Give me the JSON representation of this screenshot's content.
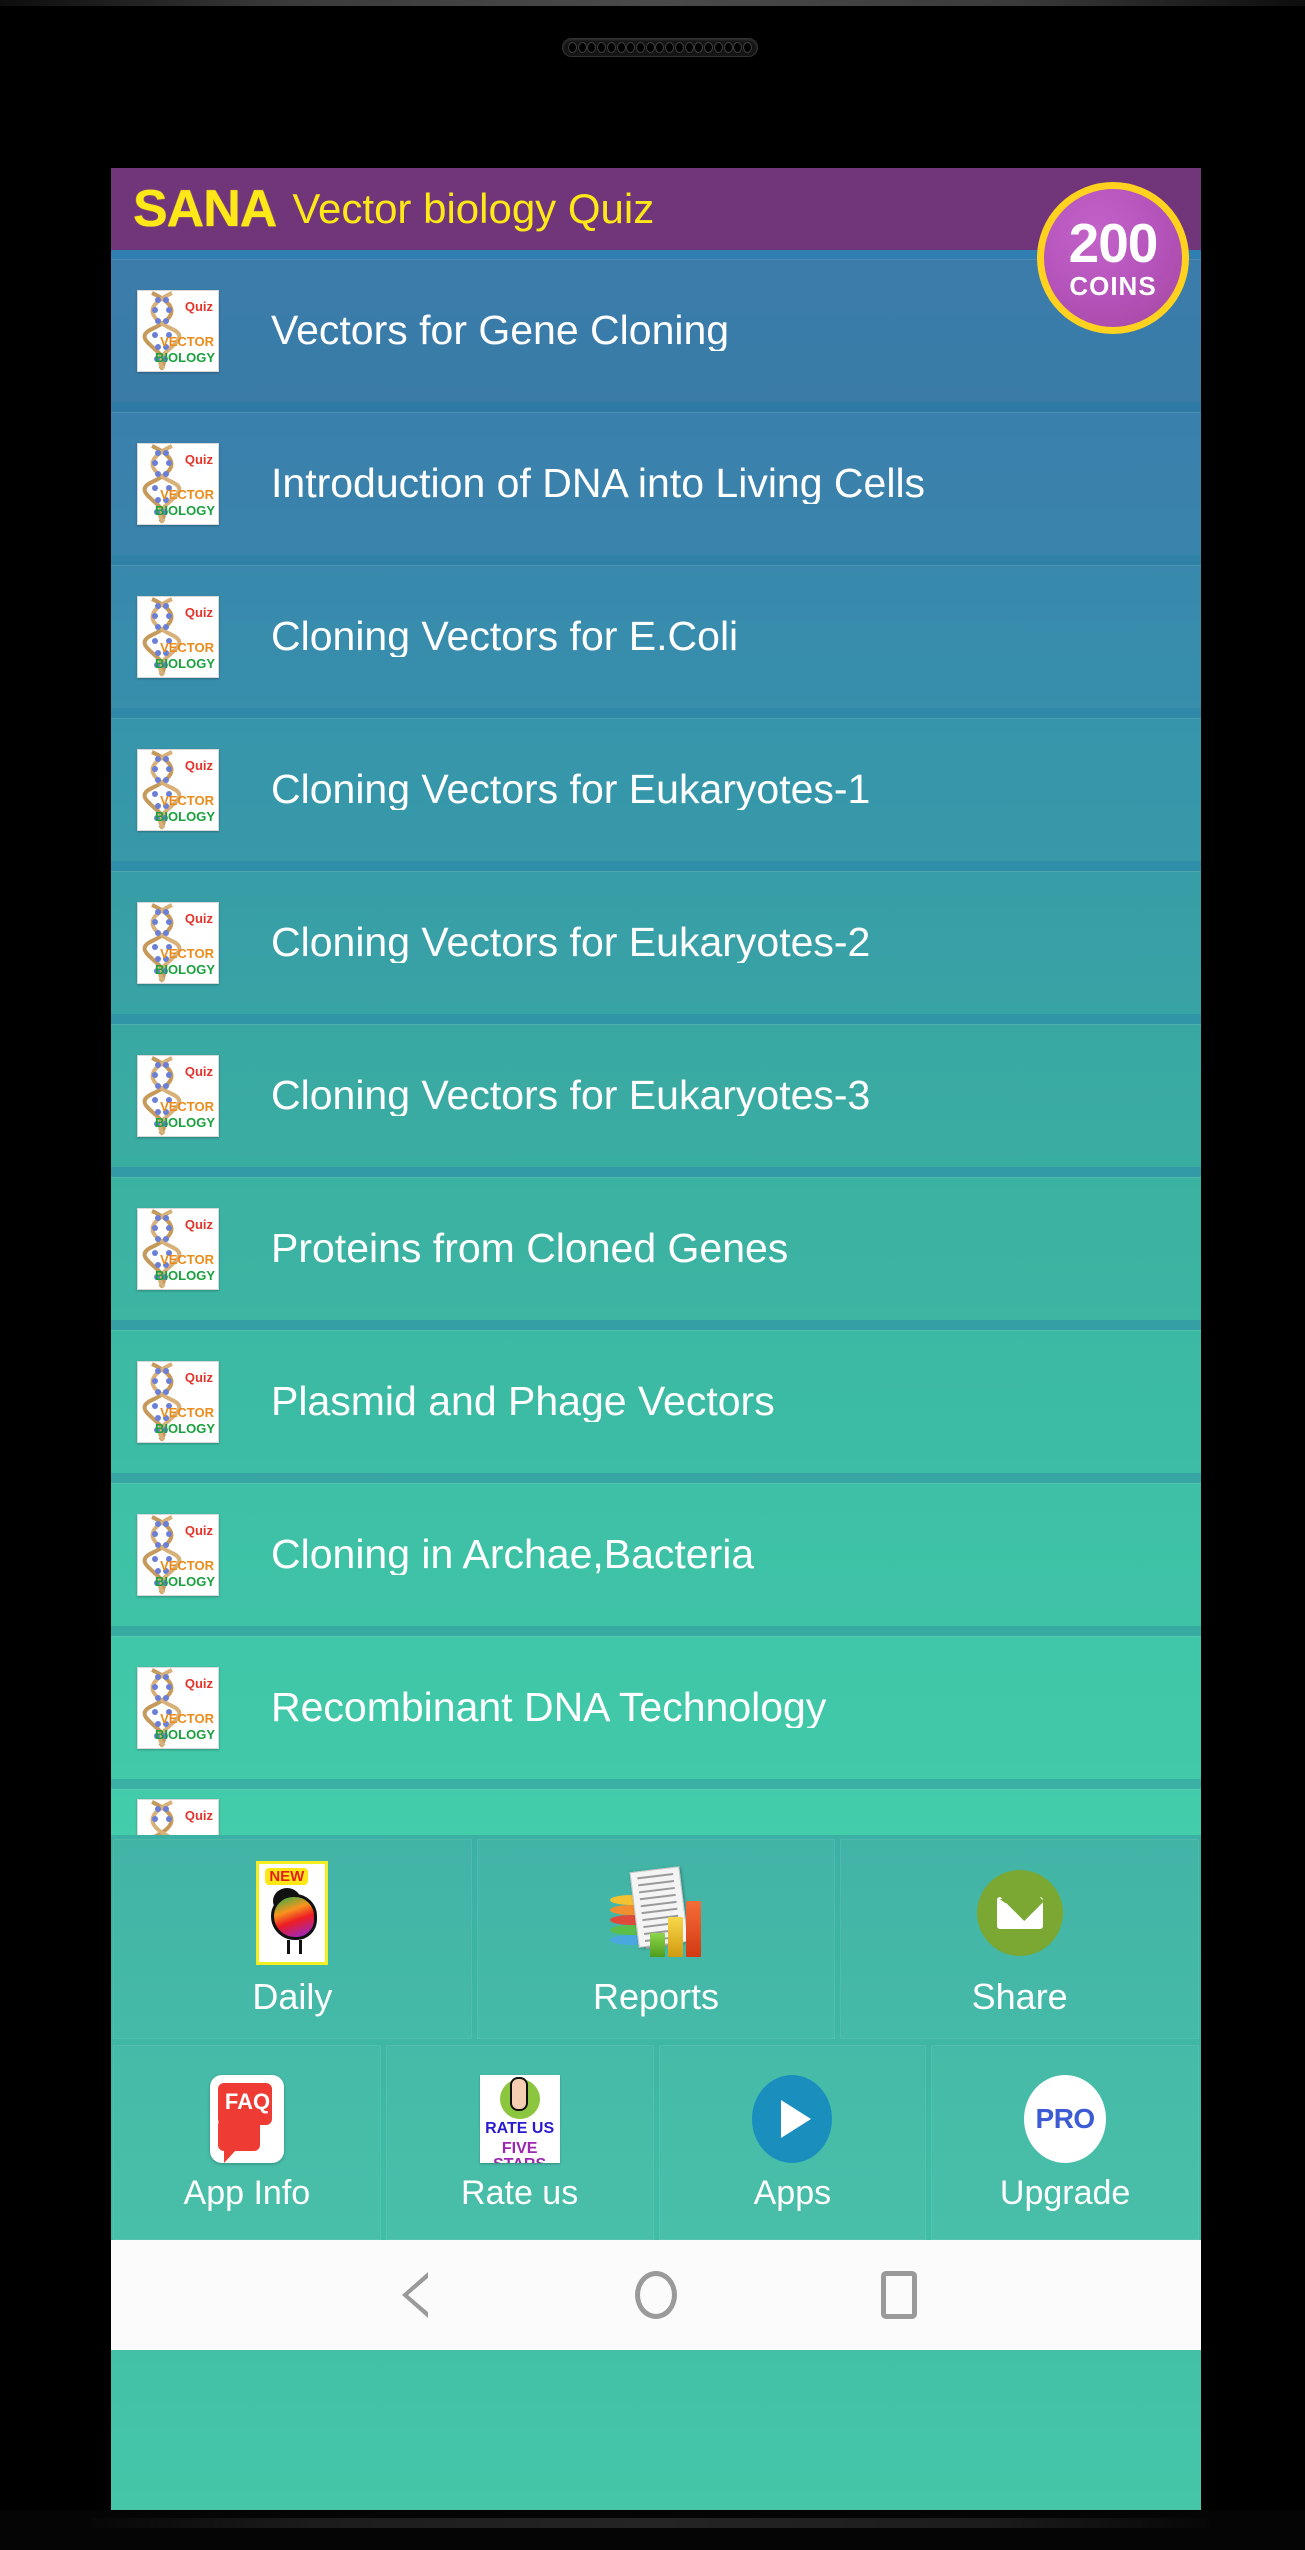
{
  "device": {
    "earpiece_label": "earpiece-speaker"
  },
  "header": {
    "logo": "SANA",
    "title": "Vector biology Quiz",
    "coin_count": "200",
    "coin_label": "COINS",
    "bg_color": "#71367a",
    "logo_color": "#ffe817"
  },
  "thumbnail": {
    "quiz_label": "Quiz",
    "vector_label": "VECTOR",
    "biology_label": "BIOLOGY"
  },
  "list": {
    "items": [
      {
        "label": "Vectors for Gene Cloning"
      },
      {
        "label": "Introduction of DNA into Living Cells"
      },
      {
        "label": "Cloning Vectors for E.Coli"
      },
      {
        "label": "Cloning Vectors for Eukaryotes-1"
      },
      {
        "label": "Cloning Vectors for Eukaryotes-2"
      },
      {
        "label": "Cloning Vectors for Eukaryotes-3"
      },
      {
        "label": "Proteins from Cloned Genes"
      },
      {
        "label": "Plasmid and Phage Vectors"
      },
      {
        "label": "Cloning in Archae,Bacteria"
      },
      {
        "label": "Recombinant DNA Technology"
      },
      {
        "label": ""
      }
    ]
  },
  "menu_top": {
    "items": [
      {
        "label": "Daily",
        "icon": "new-bird-icon"
      },
      {
        "label": "Reports",
        "icon": "reports-chart-icon"
      },
      {
        "label": "Share",
        "icon": "mail-envelope-icon"
      }
    ],
    "daily_badge": "NEW"
  },
  "menu_bottom": {
    "items": [
      {
        "label": "App Info",
        "icon": "faq-icon"
      },
      {
        "label": "Rate us",
        "icon": "thumbs-up-icon"
      },
      {
        "label": "Apps",
        "icon": "play-store-icon"
      },
      {
        "label": "Upgrade",
        "icon": "pro-badge-icon"
      }
    ],
    "faq_text": "FAQ",
    "rate_line1": "RATE US",
    "rate_line2": "FIVE STARS",
    "pro_text": "PRO"
  },
  "navbar": {
    "back": "back-button",
    "home": "home-button",
    "recents": "recents-button"
  },
  "colors": {
    "list_top": "#3a7ca5",
    "list_bottom": "#45c6a8",
    "accent_purple": "#71367a",
    "accent_yellow": "#ffd21f"
  }
}
